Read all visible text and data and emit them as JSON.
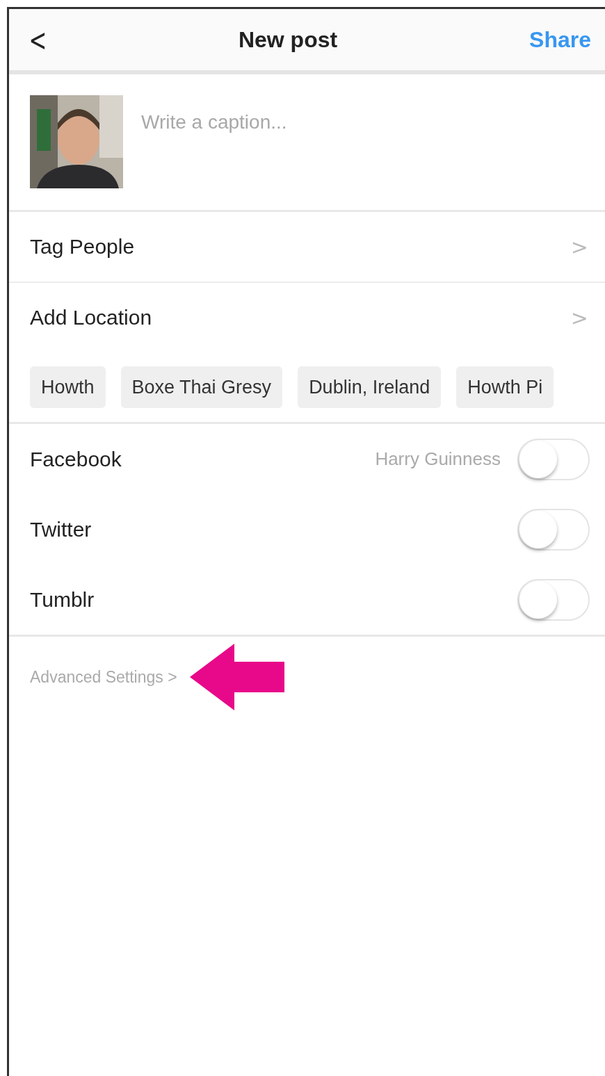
{
  "header": {
    "back": "<",
    "title": "New post",
    "action": "Share"
  },
  "caption": {
    "placeholder": "Write a caption..."
  },
  "rows": [
    {
      "label": "Tag People",
      "chevron": ">"
    },
    {
      "label": "Add Location",
      "chevron": ">"
    }
  ],
  "location_suggestions": [
    "Howth",
    "Boxe Thai Gresy",
    "Dublin, Ireland",
    "Howth Pi"
  ],
  "share_to": [
    {
      "label": "Facebook",
      "account": "Harry Guinness",
      "on": false
    },
    {
      "label": "Twitter",
      "on": false
    },
    {
      "label": "Tumblr",
      "on": false
    }
  ],
  "advanced": {
    "label": "Advanced Settings",
    "chevron": ">"
  }
}
